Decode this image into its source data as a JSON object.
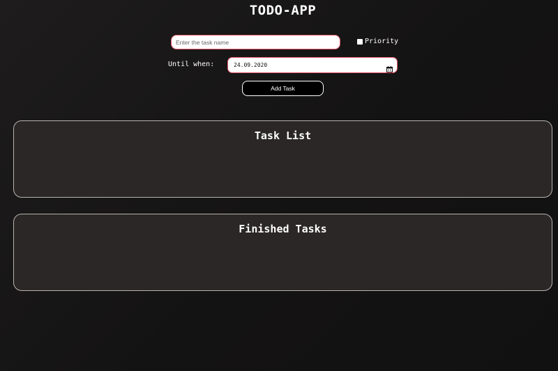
{
  "app": {
    "title": "TODO-APP"
  },
  "form": {
    "task_name": {
      "value": "",
      "placeholder": "Enter the task name"
    },
    "priority": {
      "label": "Priority",
      "checked": false
    },
    "until": {
      "label": "Until when:",
      "value": "24.09.2020",
      "icon": "calendar-icon"
    },
    "add_button_label": "Add Task"
  },
  "lists": {
    "task_list": {
      "title": "Task List",
      "items": []
    },
    "finished_tasks": {
      "title": "Finished Tasks",
      "items": []
    }
  },
  "colors": {
    "background": "#1a1818",
    "panel_background": "#2a2726",
    "panel_border": "#b9b4b2",
    "input_border": "#e65a6e",
    "button_background": "#000000",
    "text": "#ffffff"
  }
}
